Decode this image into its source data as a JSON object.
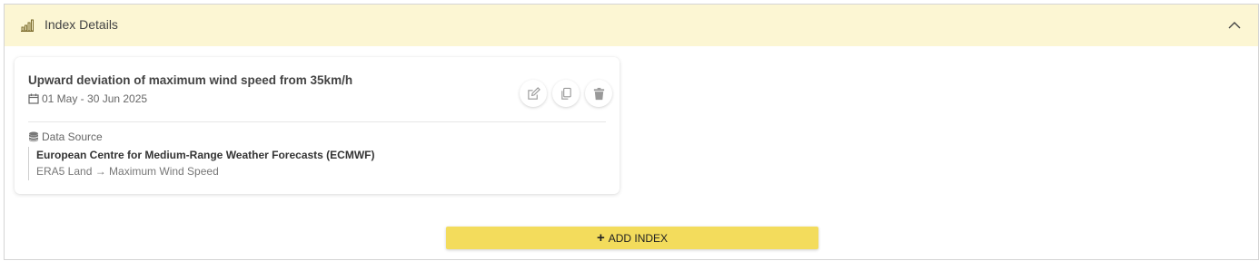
{
  "header": {
    "title": "Index Details",
    "icon": "bar-chart-icon",
    "collapse_icon": "chevron-up-icon",
    "background": "#fcf6d3"
  },
  "index_card": {
    "title": "Upward deviation of maximum wind speed from 35km/h",
    "date_icon": "calendar-icon",
    "date_range": "01 May - 30 Jun 2025",
    "actions": [
      {
        "name": "edit",
        "icon": "edit-icon"
      },
      {
        "name": "copy",
        "icon": "copy-icon"
      },
      {
        "name": "delete",
        "icon": "trash-icon"
      }
    ],
    "data_source": {
      "label": "Data Source",
      "icon": "database-icon",
      "provider": "European Centre for Medium-Range Weather Forecasts (ECMWF)",
      "path": "ERA5 Land → Maximum Wind Speed"
    }
  },
  "add_button": {
    "label": "ADD INDEX",
    "icon": "plus-icon",
    "color": "#f3dc5c"
  }
}
